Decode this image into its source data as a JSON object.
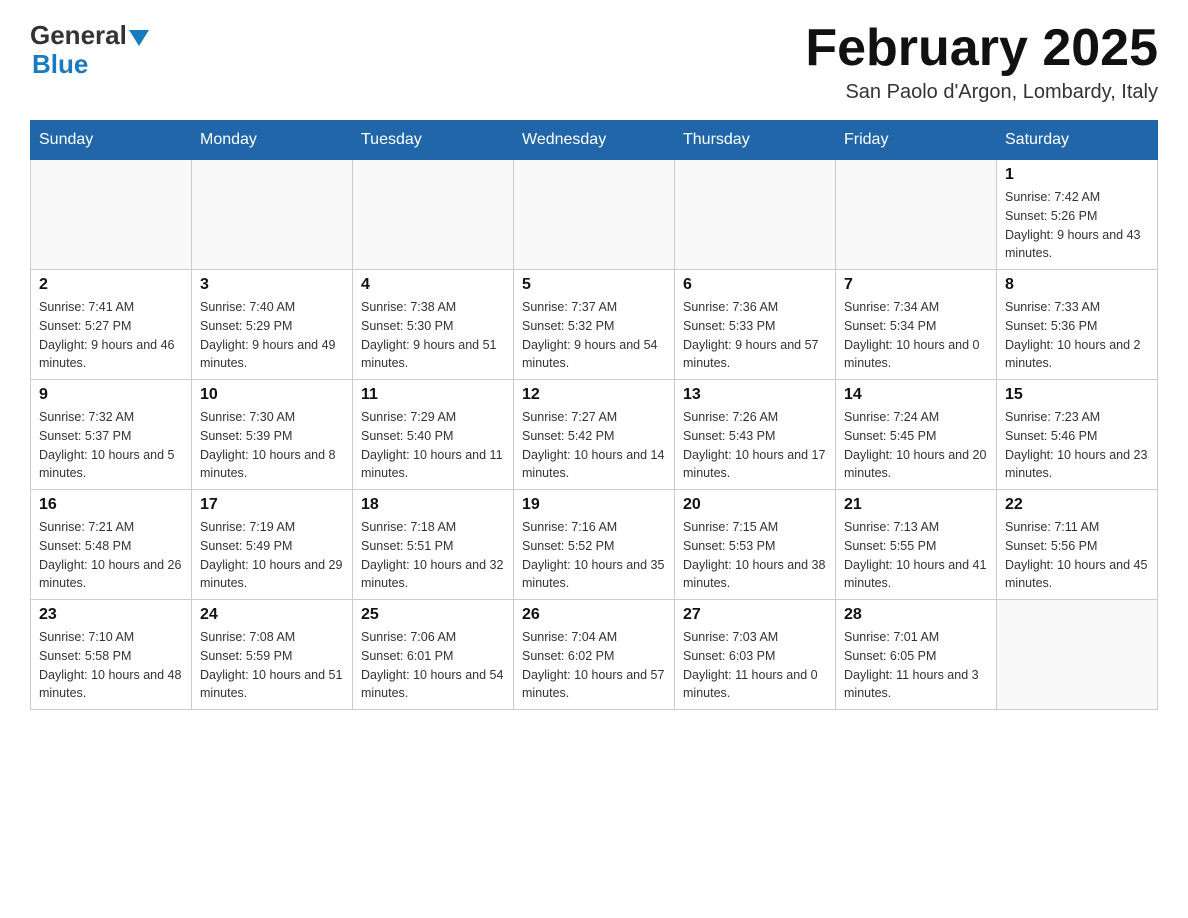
{
  "header": {
    "logo_general": "General",
    "logo_blue": "Blue",
    "month_title": "February 2025",
    "location": "San Paolo d'Argon, Lombardy, Italy"
  },
  "weekdays": [
    "Sunday",
    "Monday",
    "Tuesday",
    "Wednesday",
    "Thursday",
    "Friday",
    "Saturday"
  ],
  "weeks": [
    [
      {
        "day": "",
        "info": ""
      },
      {
        "day": "",
        "info": ""
      },
      {
        "day": "",
        "info": ""
      },
      {
        "day": "",
        "info": ""
      },
      {
        "day": "",
        "info": ""
      },
      {
        "day": "",
        "info": ""
      },
      {
        "day": "1",
        "info": "Sunrise: 7:42 AM\nSunset: 5:26 PM\nDaylight: 9 hours and 43 minutes."
      }
    ],
    [
      {
        "day": "2",
        "info": "Sunrise: 7:41 AM\nSunset: 5:27 PM\nDaylight: 9 hours and 46 minutes."
      },
      {
        "day": "3",
        "info": "Sunrise: 7:40 AM\nSunset: 5:29 PM\nDaylight: 9 hours and 49 minutes."
      },
      {
        "day": "4",
        "info": "Sunrise: 7:38 AM\nSunset: 5:30 PM\nDaylight: 9 hours and 51 minutes."
      },
      {
        "day": "5",
        "info": "Sunrise: 7:37 AM\nSunset: 5:32 PM\nDaylight: 9 hours and 54 minutes."
      },
      {
        "day": "6",
        "info": "Sunrise: 7:36 AM\nSunset: 5:33 PM\nDaylight: 9 hours and 57 minutes."
      },
      {
        "day": "7",
        "info": "Sunrise: 7:34 AM\nSunset: 5:34 PM\nDaylight: 10 hours and 0 minutes."
      },
      {
        "day": "8",
        "info": "Sunrise: 7:33 AM\nSunset: 5:36 PM\nDaylight: 10 hours and 2 minutes."
      }
    ],
    [
      {
        "day": "9",
        "info": "Sunrise: 7:32 AM\nSunset: 5:37 PM\nDaylight: 10 hours and 5 minutes."
      },
      {
        "day": "10",
        "info": "Sunrise: 7:30 AM\nSunset: 5:39 PM\nDaylight: 10 hours and 8 minutes."
      },
      {
        "day": "11",
        "info": "Sunrise: 7:29 AM\nSunset: 5:40 PM\nDaylight: 10 hours and 11 minutes."
      },
      {
        "day": "12",
        "info": "Sunrise: 7:27 AM\nSunset: 5:42 PM\nDaylight: 10 hours and 14 minutes."
      },
      {
        "day": "13",
        "info": "Sunrise: 7:26 AM\nSunset: 5:43 PM\nDaylight: 10 hours and 17 minutes."
      },
      {
        "day": "14",
        "info": "Sunrise: 7:24 AM\nSunset: 5:45 PM\nDaylight: 10 hours and 20 minutes."
      },
      {
        "day": "15",
        "info": "Sunrise: 7:23 AM\nSunset: 5:46 PM\nDaylight: 10 hours and 23 minutes."
      }
    ],
    [
      {
        "day": "16",
        "info": "Sunrise: 7:21 AM\nSunset: 5:48 PM\nDaylight: 10 hours and 26 minutes."
      },
      {
        "day": "17",
        "info": "Sunrise: 7:19 AM\nSunset: 5:49 PM\nDaylight: 10 hours and 29 minutes."
      },
      {
        "day": "18",
        "info": "Sunrise: 7:18 AM\nSunset: 5:51 PM\nDaylight: 10 hours and 32 minutes."
      },
      {
        "day": "19",
        "info": "Sunrise: 7:16 AM\nSunset: 5:52 PM\nDaylight: 10 hours and 35 minutes."
      },
      {
        "day": "20",
        "info": "Sunrise: 7:15 AM\nSunset: 5:53 PM\nDaylight: 10 hours and 38 minutes."
      },
      {
        "day": "21",
        "info": "Sunrise: 7:13 AM\nSunset: 5:55 PM\nDaylight: 10 hours and 41 minutes."
      },
      {
        "day": "22",
        "info": "Sunrise: 7:11 AM\nSunset: 5:56 PM\nDaylight: 10 hours and 45 minutes."
      }
    ],
    [
      {
        "day": "23",
        "info": "Sunrise: 7:10 AM\nSunset: 5:58 PM\nDaylight: 10 hours and 48 minutes."
      },
      {
        "day": "24",
        "info": "Sunrise: 7:08 AM\nSunset: 5:59 PM\nDaylight: 10 hours and 51 minutes."
      },
      {
        "day": "25",
        "info": "Sunrise: 7:06 AM\nSunset: 6:01 PM\nDaylight: 10 hours and 54 minutes."
      },
      {
        "day": "26",
        "info": "Sunrise: 7:04 AM\nSunset: 6:02 PM\nDaylight: 10 hours and 57 minutes."
      },
      {
        "day": "27",
        "info": "Sunrise: 7:03 AM\nSunset: 6:03 PM\nDaylight: 11 hours and 0 minutes."
      },
      {
        "day": "28",
        "info": "Sunrise: 7:01 AM\nSunset: 6:05 PM\nDaylight: 11 hours and 3 minutes."
      },
      {
        "day": "",
        "info": ""
      }
    ]
  ]
}
